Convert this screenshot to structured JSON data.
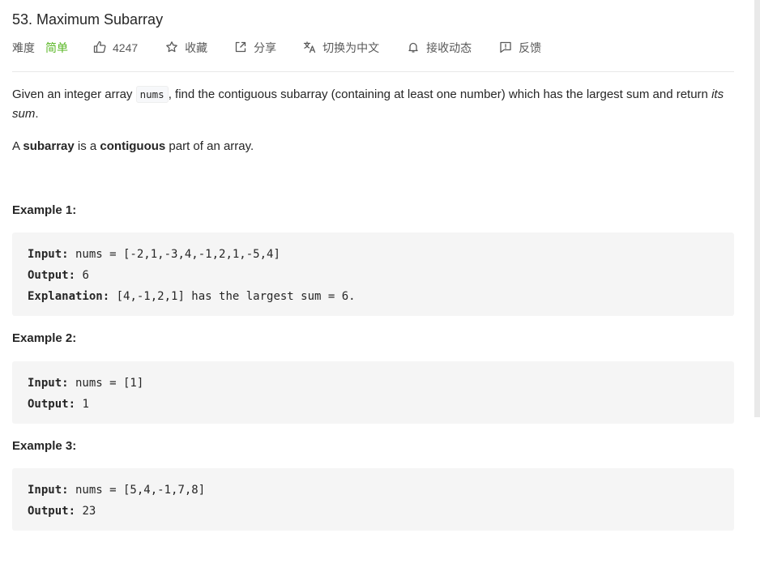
{
  "problem": {
    "title": "53. Maximum Subarray",
    "toolbar": {
      "difficulty_label": "难度",
      "difficulty": "简单",
      "likes": "4247",
      "favorite": "收藏",
      "share": "分享",
      "switch_lang": "切换为中文",
      "notify": "接收动态",
      "feedback": "反馈"
    },
    "description": {
      "p1_before": "Given an integer array ",
      "p1_code": "nums",
      "p1_after": ", find the contiguous subarray (containing at least one number) which has the largest sum and return ",
      "p1_em": "its sum",
      "p1_end": ".",
      "p2_a": "A ",
      "p2_b": "subarray",
      "p2_c": " is a ",
      "p2_d": "contiguous",
      "p2_e": " part of an array."
    },
    "examples": [
      {
        "title": "Example 1:",
        "input_label": "Input:",
        "input": " nums = [-2,1,-3,4,-1,2,1,-5,4]",
        "output_label": "Output:",
        "output": " 6",
        "explanation_label": "Explanation:",
        "explanation": " [4,-1,2,1] has the largest sum = 6."
      },
      {
        "title": "Example 2:",
        "input_label": "Input:",
        "input": " nums = [1]",
        "output_label": "Output:",
        "output": " 1"
      },
      {
        "title": "Example 3:",
        "input_label": "Input:",
        "input": " nums = [5,4,-1,7,8]",
        "output_label": "Output:",
        "output": " 23"
      }
    ]
  },
  "colors": {
    "difficulty_easy": "#5ab726",
    "code_bg": "#f5f5f5",
    "text": "#262626"
  },
  "icons": [
    "thumbs-up-icon",
    "star-icon",
    "share-icon",
    "translate-icon",
    "bell-icon",
    "feedback-icon"
  ]
}
